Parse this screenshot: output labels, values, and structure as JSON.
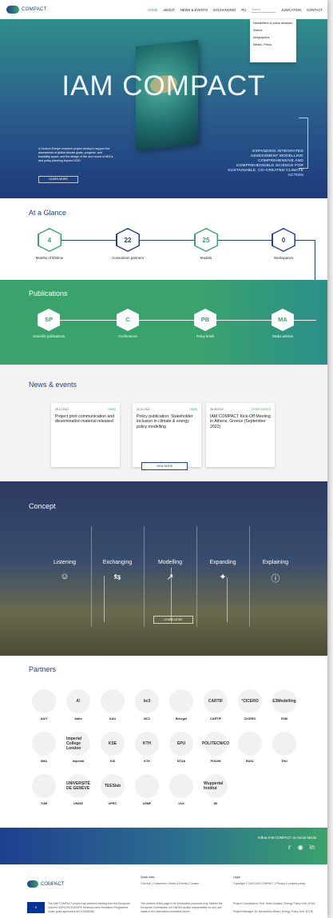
{
  "header": {
    "logo_text": "COMPACT",
    "nav": [
      "HOME",
      "ABOUT",
      "NEWS & EVENTS",
      "EXCHANGING",
      "PU"
    ],
    "search_placeholder": "Search",
    "nav_right": [
      "JUNICATION",
      "CONTACT"
    ]
  },
  "dropdown": [
    "Newsletters & press releases",
    "Videos",
    "Infographics",
    "Media / Press"
  ],
  "hero": {
    "title": "IAM COMPACT",
    "description": "A Horizon Europe research project aiming to support the assessment of global climate goals, progress, and feasibility space, and the design of the next round of NDCs and policy planning beyond 2030.",
    "button": "LEARN MORE",
    "tagline_lines": [
      "EXPANDING INTEGRATED",
      "ASSESSMENT MODELLING",
      "COMPREHENSIVE AND",
      "COMPREHENSIBLE SCIENCE FOR",
      "SUSTAINABLE, CO-CREATED CLIMATE",
      "ACTION"
    ]
  },
  "glance": {
    "title": "At a Glance",
    "items": [
      {
        "value": "4",
        "label": "Months of lifetime"
      },
      {
        "value": "22",
        "label": "Consortium partners"
      },
      {
        "value": "25",
        "label": "Models"
      },
      {
        "value": "0",
        "label": "Workspaces"
      }
    ]
  },
  "publications": {
    "title": "Publications",
    "items": [
      {
        "abbr": "SP",
        "label": "Scientific publications"
      },
      {
        "abbr": "C",
        "label": "Conferences"
      },
      {
        "abbr": "PB",
        "label": "Policy briefs"
      },
      {
        "abbr": "MA",
        "label": "Media articles"
      }
    ]
  },
  "news": {
    "title": "News & events",
    "cards": [
      {
        "date": "05.12.2022",
        "tag": "NEWS",
        "title": "Project print communication and dissemination material released"
      },
      {
        "date": "23.11.2022",
        "tag": "NEWS",
        "title": "Policy publication: Stakeholder inclusion in climate & energy policy modelling"
      },
      {
        "date": "08.09.2022",
        "tag": "OTHER EVENTS",
        "title": "IAM COMPACT Kick-Off Meeting in Athens, Greece (September 2022)"
      }
    ],
    "view_more": "VIEW MORE"
  },
  "concept": {
    "title": "Concept",
    "items": [
      {
        "label": "Listening",
        "icon": "ear-icon"
      },
      {
        "label": "Exchanging",
        "icon": "exchange-arrows-icon"
      },
      {
        "label": "Modelling",
        "icon": "chart-icon"
      },
      {
        "label": "Expanding",
        "icon": "network-icon"
      },
      {
        "label": "Explaining",
        "icon": "info-icon"
      }
    ],
    "button": "LEARN MORE"
  },
  "partners": {
    "title": "Partners",
    "items": [
      "AAIT",
      "Aalto",
      "AAU",
      "BC3",
      "Bruegel",
      "CARTIF",
      "CICERO",
      "E3M",
      "IIMA",
      "Imperial",
      "KSI",
      "KTH",
      "NTUA",
      "POLIMI",
      "RUSL",
      "THU",
      "TUM",
      "UNIGE",
      "UPRC",
      "USMF",
      "UVa",
      "WI"
    ],
    "logo_texts": [
      "",
      "A!",
      "",
      "bc3",
      "",
      "CARTIF",
      "°CICERO",
      "E3Modelling",
      "",
      "Imperial College London",
      "KSE",
      "KTH",
      "EPU",
      "POLITECNICO",
      "",
      "",
      "",
      "UNIVERSITÉ DE GENÈVE",
      "TEESlab",
      "",
      "",
      "Wuppertal Institut"
    ]
  },
  "social": {
    "title": "Follow IAM COMPACT on Social Media",
    "icons": [
      "twitter-icon",
      "instagram-icon",
      "linkedin-icon"
    ]
  },
  "footer": {
    "logo_text": "COMPACT",
    "quick_links_title": "Quick links",
    "quick_links": "Concept  |  Consortium  |  News & Events  |  Contact",
    "legal_title": "Legal",
    "legal_text": "Copyright © 2022 IAM COMPACT  |  Privacy & cookies policy",
    "eu_text": "The IAM COMPACT project has received funding from the European Union's HORIZON EUROPE Research and Innovation Programme under grant agreement No 101056306.",
    "disclaimer": "The content of this page is for information purposes only. Neither the European Commission nor HaDEA accept responsibility for any use made of the information contained herein.",
    "coordination": "Project Coordination: Prof. Haris Doukas | Energy Policy Unit, NTUA",
    "manager": "Project Manager: Dr. Alexandros Nikas | Energy Policy Unit, NTUA"
  }
}
